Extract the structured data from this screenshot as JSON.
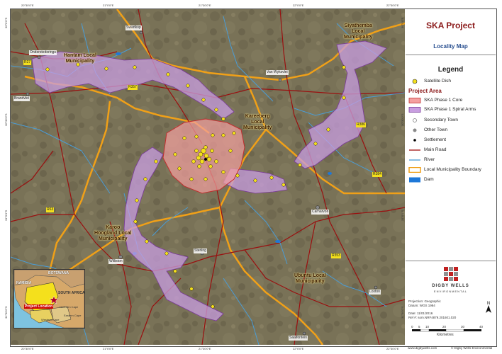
{
  "title": {
    "main": "SKA Project",
    "sub": "Locality Map"
  },
  "legend": {
    "title": "Legend",
    "items_top": [
      {
        "label": "Satellite Dish",
        "symbol": "yellow-dot"
      }
    ],
    "project_area_heading": "Project Area",
    "project_area_items": [
      {
        "label": "SKA Phase 1 Core",
        "symbol": "pink-fill"
      },
      {
        "label": "SKA Phase 1 Spiral Arms",
        "symbol": "purple-fill"
      }
    ],
    "items_bottom": [
      {
        "label": "Secondary Town",
        "symbol": "circle-open"
      },
      {
        "label": "Other Town",
        "symbol": "grey-dot"
      },
      {
        "label": "Settlement",
        "symbol": "black-dot"
      },
      {
        "label": "Main Road",
        "symbol": "red-line"
      },
      {
        "label": "River",
        "symbol": "blue-line"
      },
      {
        "label": "Local Municipality Boundary",
        "symbol": "orange-line"
      },
      {
        "label": "Dam",
        "symbol": "blue-fill"
      }
    ]
  },
  "colors": {
    "core": "#f4a0a0",
    "arms": "#c89ee0",
    "road": "#a01010",
    "river": "#4a9cd6",
    "boundary": "#f0a018",
    "dam": "#1e78d8",
    "dish": "#f4e01c"
  },
  "logo": {
    "name": "DIGBY WELLS",
    "sub": "ENVIRONMENTAL"
  },
  "info": {
    "projection": "Projection: Geographic",
    "datum": "Datum: WGS 1984",
    "date": "Date: 11/01/2016",
    "ref": "Ref #: som.NRF4879.201601.020"
  },
  "scale": {
    "ticks": [
      "0",
      "5",
      "10",
      "20",
      "30",
      "40"
    ],
    "unit": "Kilometres"
  },
  "footer": {
    "website": "www.digbywells.com",
    "copyright": "© Digby Wells Environmental"
  },
  "map": {
    "towns": [
      "Swartkop",
      "Onderstedorings",
      "Brandvlei",
      "Van Wyksvlei",
      "Carnarvon",
      "Williston",
      "Sterling",
      "Loxton",
      "Saaifontein"
    ],
    "municipalities": [
      {
        "id": "hantam",
        "lines": [
          "Hantam Local",
          "Municipality"
        ]
      },
      {
        "id": "siyathemba",
        "lines": [
          "Siyathemba",
          "Local",
          "Municipality"
        ]
      },
      {
        "id": "kareeberg",
        "lines": [
          "Kareeberg",
          "Local",
          "Municipality"
        ]
      },
      {
        "id": "karoo",
        "lines": [
          "Karoo",
          "Hoogland Local",
          "Municipality"
        ]
      },
      {
        "id": "ubuntu",
        "lines": [
          "Ubuntu Local",
          "Municipality"
        ]
      }
    ],
    "roads": [
      "R27",
      "R357",
      "R386",
      "R63",
      "R384",
      "R353"
    ],
    "coords_top": [
      "20°30'0\"E",
      "21°0'0\"E",
      "21°30'0\"E",
      "22°0'0\"E",
      "22°30'0\"E"
    ],
    "coords_bottom": [
      "20°30'0\"E",
      "21°0'0\"E",
      "21°30'0\"E",
      "22°0'0\"E",
      "22°30'0\"E"
    ],
    "coords_left": [
      "30°0'0\"S",
      "30°30'0\"S",
      "31°0'0\"S",
      "31°30'0\"S"
    ],
    "coords_right": [
      "30°0'0\"S",
      "30°30'0\"S",
      "31°0'0\"S",
      "31°30'0\"S"
    ]
  },
  "inset": {
    "countries": [
      "BOTSWANA",
      "NAMIBIA",
      "SOUTH AFRICA"
    ],
    "provinces": [
      "Northern Cape",
      "Western Cape",
      "Eastern Cape"
    ],
    "project_label": "Project Location"
  }
}
